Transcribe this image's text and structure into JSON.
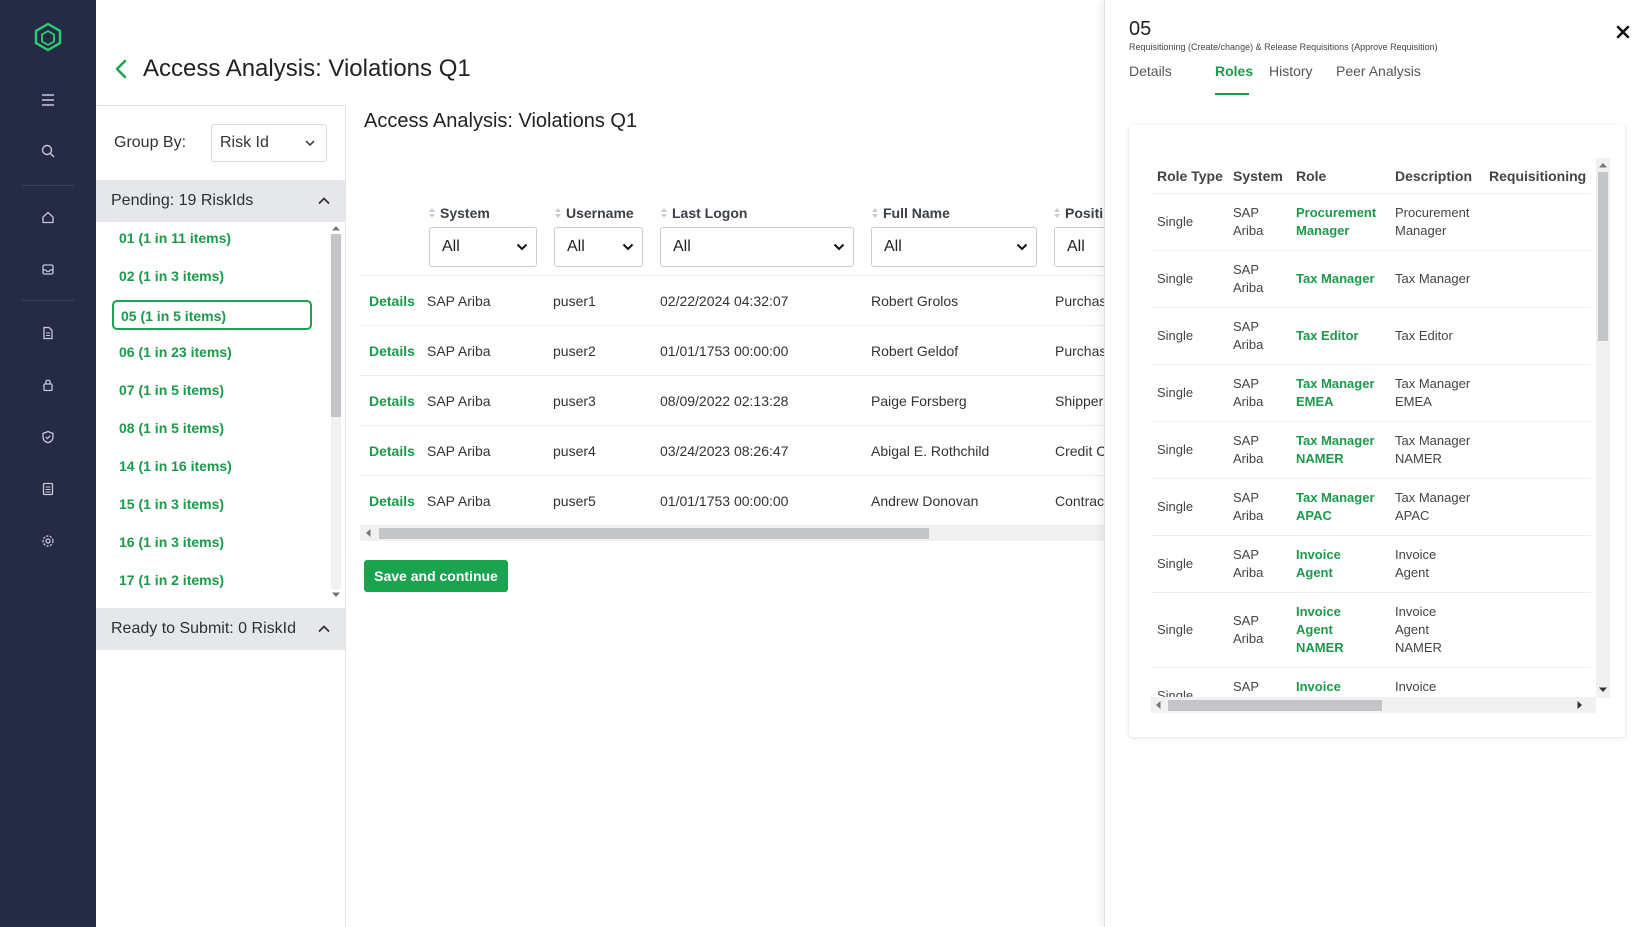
{
  "nav": {
    "icons": [
      "app-logo-icon",
      "menu-icon",
      "search-icon",
      "home-icon",
      "inbox-icon",
      "document-icon",
      "lock-icon",
      "shield-check-icon",
      "report-icon",
      "settings-icon"
    ]
  },
  "header": {
    "title": "Access Analysis: Violations Q1"
  },
  "group_panel": {
    "group_by_label": "Group By:",
    "group_by_value": "Risk Id",
    "pending_label": "Pending: 19 RiskIds",
    "risk_items": [
      "01 (1 in 11 items)",
      "02 (1 in 3 items)",
      "05 (1 in 5 items)",
      "06 (1 in 23 items)",
      "07 (1 in 5 items)",
      "08 (1 in 5 items)",
      "14 (1 in 16 items)",
      "15 (1 in 3 items)",
      "16 (1 in 3 items)",
      "17 (1 in 2 items)"
    ],
    "selected_index": 2,
    "ready_label": "Ready to Submit: 0 RiskId"
  },
  "main": {
    "title": "Access Analysis: Violations Q1",
    "columns": [
      "System",
      "Username",
      "Last Logon",
      "Full Name",
      "Positi"
    ],
    "filters": [
      "All",
      "All",
      "All",
      "All",
      "All"
    ],
    "rows": [
      {
        "action": "Details",
        "system": "SAP Ariba",
        "username": "puser1",
        "last_logon": "02/22/2024 04:32:07",
        "full_name": "Robert Grolos",
        "position": "Purchasi"
      },
      {
        "action": "Details",
        "system": "SAP Ariba",
        "username": "puser2",
        "last_logon": "01/01/1753 00:00:00",
        "full_name": "Robert Geldof",
        "position": "Purchasi"
      },
      {
        "action": "Details",
        "system": "SAP Ariba",
        "username": "puser3",
        "last_logon": "08/09/2022 02:13:28",
        "full_name": "Paige Forsberg",
        "position": "Shippers"
      },
      {
        "action": "Details",
        "system": "SAP Ariba",
        "username": "puser4",
        "last_logon": "03/24/2023 08:26:47",
        "full_name": "Abigal E. Rothchild",
        "position": "Credit C"
      },
      {
        "action": "Details",
        "system": "SAP Ariba",
        "username": "puser5",
        "last_logon": "01/01/1753 00:00:00",
        "full_name": "Andrew Donovan",
        "position": "Contract"
      }
    ],
    "save_label": "Save and continue"
  },
  "drawer": {
    "risk_id": "05",
    "risk_description": "Requisitioning (Create/change) & Release Requisitions (Approve Requisition)",
    "tabs": [
      "Details",
      "Roles",
      "History",
      "Peer Analysis"
    ],
    "active_tab": "Roles",
    "roles_table": {
      "columns": [
        "Role Type",
        "System",
        "Role",
        "Description",
        "Requisitioning ("
      ],
      "rows": [
        {
          "role_type": "Single",
          "system": [
            "SAP",
            "Ariba"
          ],
          "role": [
            "Procurement",
            "Manager"
          ],
          "description": [
            "Procurement",
            "Manager"
          ]
        },
        {
          "role_type": "Single",
          "system": [
            "SAP",
            "Ariba"
          ],
          "role": [
            "Tax Manager"
          ],
          "description": [
            "Tax Manager"
          ]
        },
        {
          "role_type": "Single",
          "system": [
            "SAP",
            "Ariba"
          ],
          "role": [
            "Tax Editor"
          ],
          "description": [
            "Tax Editor"
          ]
        },
        {
          "role_type": "Single",
          "system": [
            "SAP",
            "Ariba"
          ],
          "role": [
            "Tax Manager",
            "EMEA"
          ],
          "description": [
            "Tax Manager",
            "EMEA"
          ]
        },
        {
          "role_type": "Single",
          "system": [
            "SAP",
            "Ariba"
          ],
          "role": [
            "Tax Manager",
            "NAMER"
          ],
          "description": [
            "Tax Manager",
            "NAMER"
          ]
        },
        {
          "role_type": "Single",
          "system": [
            "SAP",
            "Ariba"
          ],
          "role": [
            "Tax Manager",
            "APAC"
          ],
          "description": [
            "Tax Manager",
            "APAC"
          ]
        },
        {
          "role_type": "Single",
          "system": [
            "SAP",
            "Ariba"
          ],
          "role": [
            "Invoice",
            "Agent"
          ],
          "description": [
            "Invoice",
            "Agent"
          ]
        },
        {
          "role_type": "Single",
          "system": [
            "SAP",
            "Ariba"
          ],
          "role": [
            "Invoice",
            "Agent",
            "NAMER"
          ],
          "description": [
            "Invoice",
            "Agent",
            "NAMER"
          ]
        },
        {
          "role_type": "Single",
          "system": [
            "SAP"
          ],
          "role": [
            "Invoice"
          ],
          "description": [
            "Invoice"
          ]
        }
      ]
    }
  }
}
